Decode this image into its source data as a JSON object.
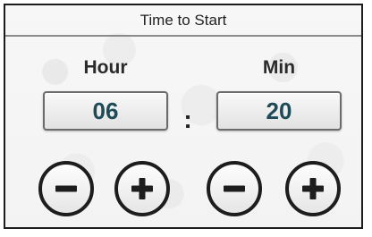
{
  "panel": {
    "title": "Time to Start"
  },
  "hour": {
    "label": "Hour",
    "value": "06",
    "decrement_icon": "minus-icon",
    "increment_icon": "plus-icon"
  },
  "minute": {
    "label": "Min",
    "value": "20",
    "decrement_icon": "minus-icon",
    "increment_icon": "plus-icon"
  },
  "separator": ":",
  "colors": {
    "value_text": "#1f4a57",
    "button_border": "#1d1d1d"
  }
}
